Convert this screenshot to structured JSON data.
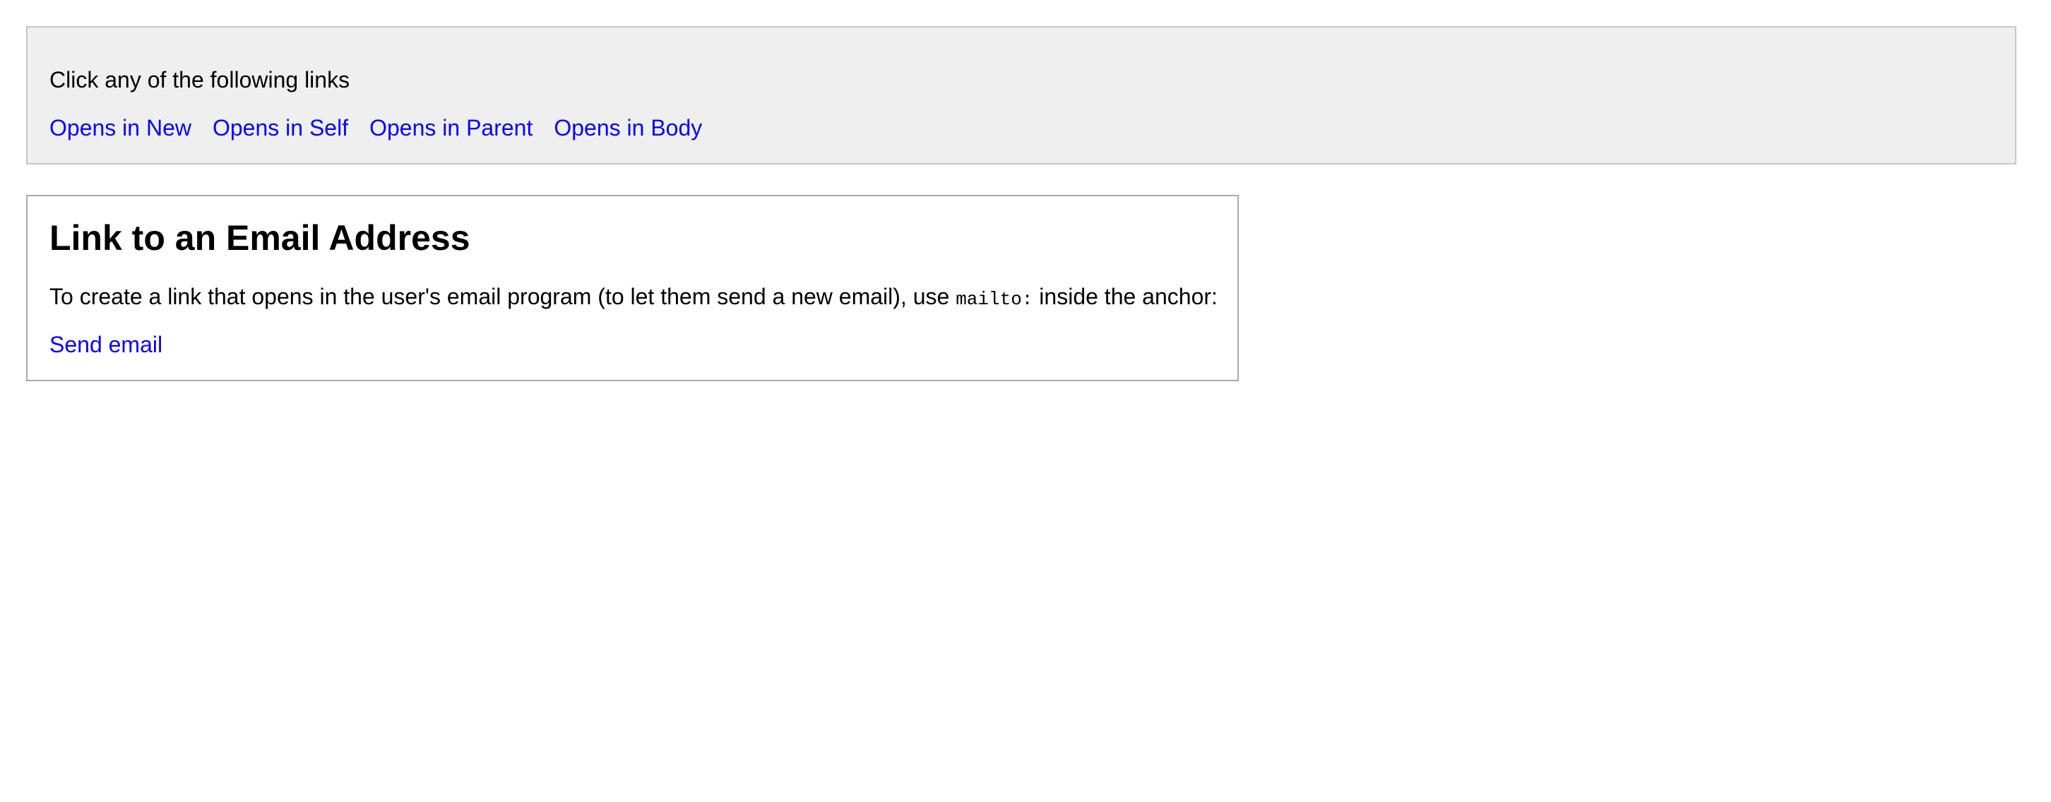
{
  "links_panel": {
    "intro": "Click any of the following links",
    "links": [
      {
        "label": "Opens in New"
      },
      {
        "label": "Opens in Self"
      },
      {
        "label": "Opens in Parent"
      },
      {
        "label": "Opens in Body"
      }
    ]
  },
  "email_section": {
    "heading": "Link to an Email Address",
    "description_before": "To create a link that opens in the user's email program (to let them send a new email), use ",
    "description_code": "mailto:",
    "description_after": " inside the anchor:",
    "link_label": "Send email"
  },
  "colors": {
    "link": "#0a00ff",
    "panel_background": "#efefef",
    "panel_border": "#c6c6c6",
    "section_border": "#a9a9a9"
  }
}
